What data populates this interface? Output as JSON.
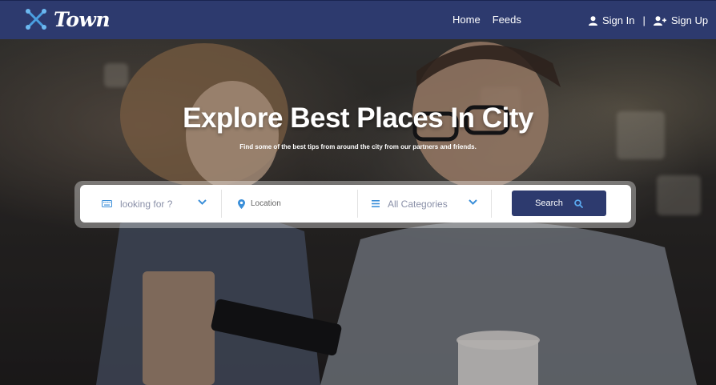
{
  "brand": {
    "name": "Town"
  },
  "nav": {
    "links": [
      "Home",
      "Feeds"
    ],
    "sign_in": "Sign In",
    "separator": "|",
    "sign_up": "Sign Up"
  },
  "hero": {
    "title": "Explore Best Places In City",
    "subtitle": "Find some of the best tips from around the city from our partners and friends."
  },
  "search": {
    "keyword_placeholder": "looking for ?",
    "location_placeholder": "Location",
    "category_value": "All Categories",
    "button_label": "Search"
  },
  "colors": {
    "navbar": "#2d3a6e",
    "accent": "#3b8fd9",
    "button": "#2d3a6e"
  },
  "icons": {
    "logo": "x-dots-logo-icon",
    "sign_in": "user-icon",
    "sign_up": "user-plus-icon",
    "keyword": "keyboard-icon",
    "location": "map-pin-icon",
    "category": "list-icon",
    "chevron": "chevron-down-icon",
    "search": "search-icon"
  }
}
